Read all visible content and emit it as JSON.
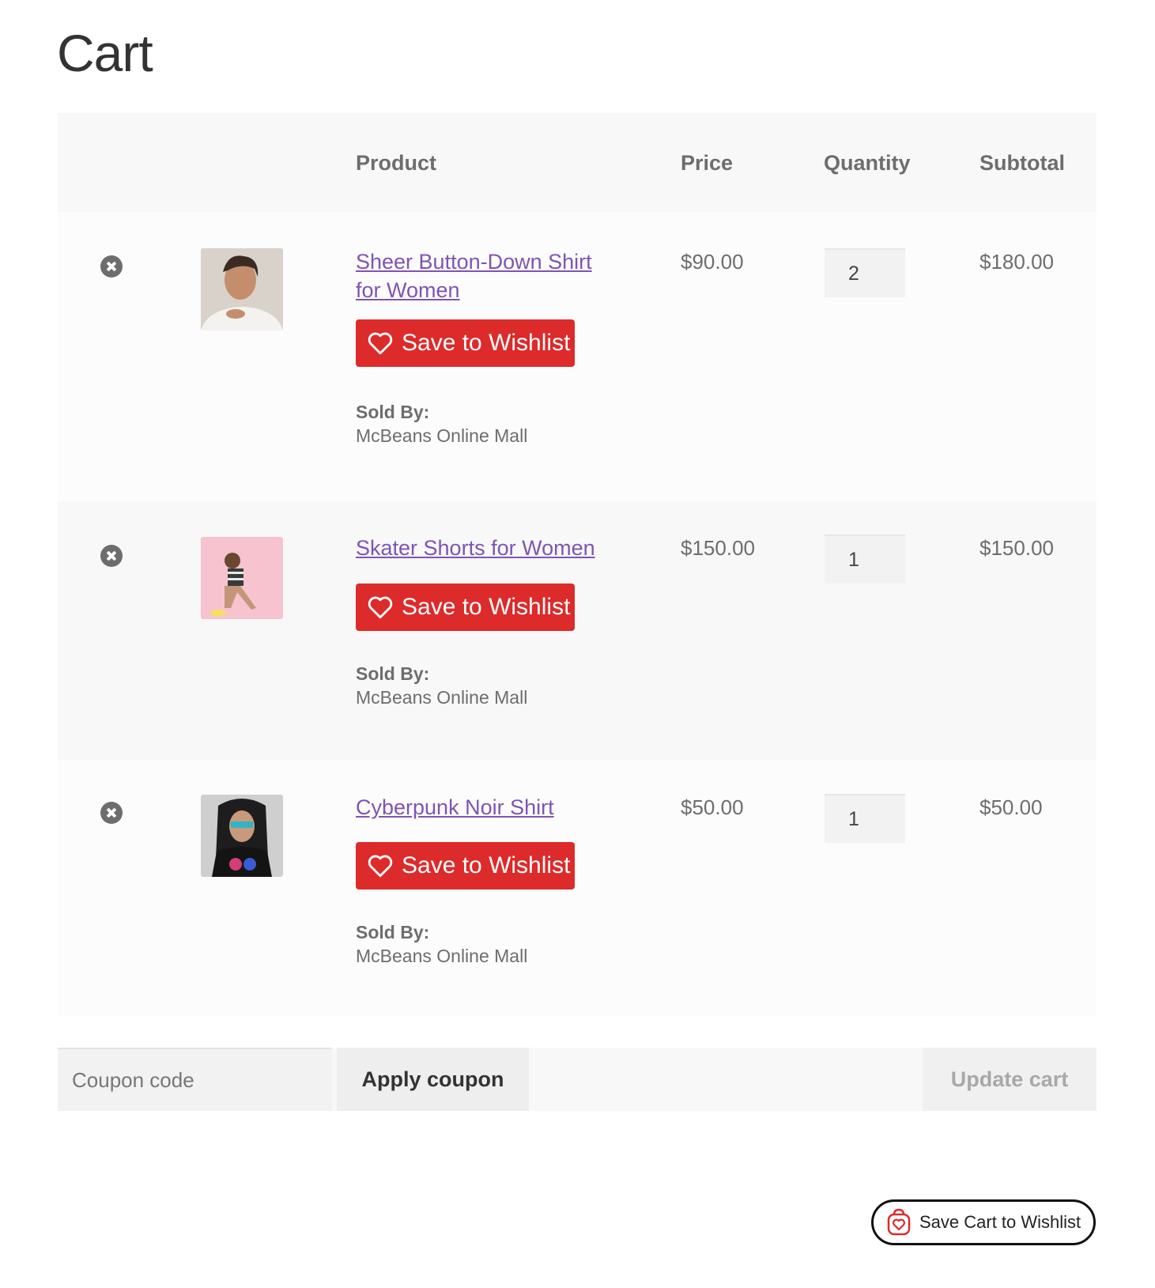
{
  "page": {
    "title": "Cart"
  },
  "table": {
    "headers": {
      "product": "Product",
      "price": "Price",
      "quantity": "Quantity",
      "subtotal": "Subtotal"
    }
  },
  "items": [
    {
      "name": "Sheer Button-Down Shirt for Women",
      "price": "$90.00",
      "quantity": "2",
      "subtotal": "$180.00",
      "wishlist_label": "Save to Wishlist",
      "sold_by_label": "Sold By:",
      "sold_by": "McBeans Online Mall"
    },
    {
      "name": "Skater Shorts for Women",
      "price": "$150.00",
      "quantity": "1",
      "subtotal": "$150.00",
      "wishlist_label": "Save to Wishlist",
      "sold_by_label": "Sold By:",
      "sold_by": "McBeans Online Mall"
    },
    {
      "name": "Cyberpunk Noir Shirt",
      "price": "$50.00",
      "quantity": "1",
      "subtotal": "$50.00",
      "wishlist_label": "Save to Wishlist",
      "sold_by_label": "Sold By:",
      "sold_by": "McBeans Online Mall"
    }
  ],
  "actions": {
    "coupon_placeholder": "Coupon code",
    "apply_label": "Apply coupon",
    "update_label": "Update cart"
  },
  "save_cart": {
    "label": "Save Cart to Wishlist"
  },
  "colors": {
    "wishlist_red": "#dd2a2a",
    "link_purple": "#7f54b3",
    "text_gray": "#6d6d6d"
  }
}
